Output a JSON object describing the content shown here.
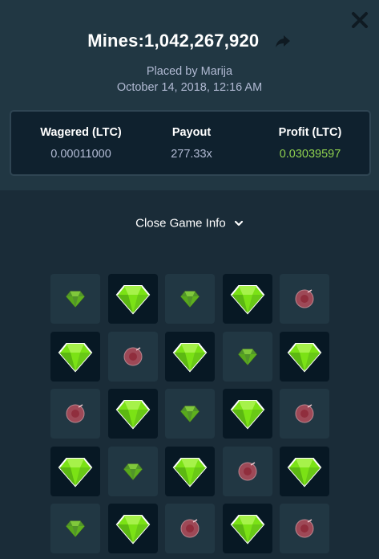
{
  "header": {
    "title": "Mines:1,042,267,920",
    "placed_by": "Placed by Marija",
    "date": "October 14, 2018, 12:16 AM"
  },
  "stats": [
    {
      "label": "Wagered (LTC)",
      "value": "0.00011000",
      "highlight": false
    },
    {
      "label": "Payout",
      "value": "277.33x",
      "highlight": false
    },
    {
      "label": "Profit (LTC)",
      "value": "0.03039597",
      "highlight": true
    }
  ],
  "toggle_label": "Close Game Info",
  "colors": {
    "gem": "#7be215",
    "mine": "#c8505e",
    "profit": "#8fd14f"
  },
  "grid": [
    [
      "gem-small",
      "gem-revealed",
      "gem-small",
      "gem-revealed",
      "mine"
    ],
    [
      "gem-revealed",
      "mine",
      "gem-revealed",
      "gem-small",
      "gem-revealed"
    ],
    [
      "mine",
      "gem-revealed",
      "gem-small",
      "gem-revealed",
      "mine"
    ],
    [
      "gem-revealed",
      "gem-small",
      "gem-revealed",
      "mine",
      "gem-revealed"
    ],
    [
      "gem-small",
      "gem-revealed",
      "mine",
      "gem-revealed",
      "mine"
    ]
  ]
}
